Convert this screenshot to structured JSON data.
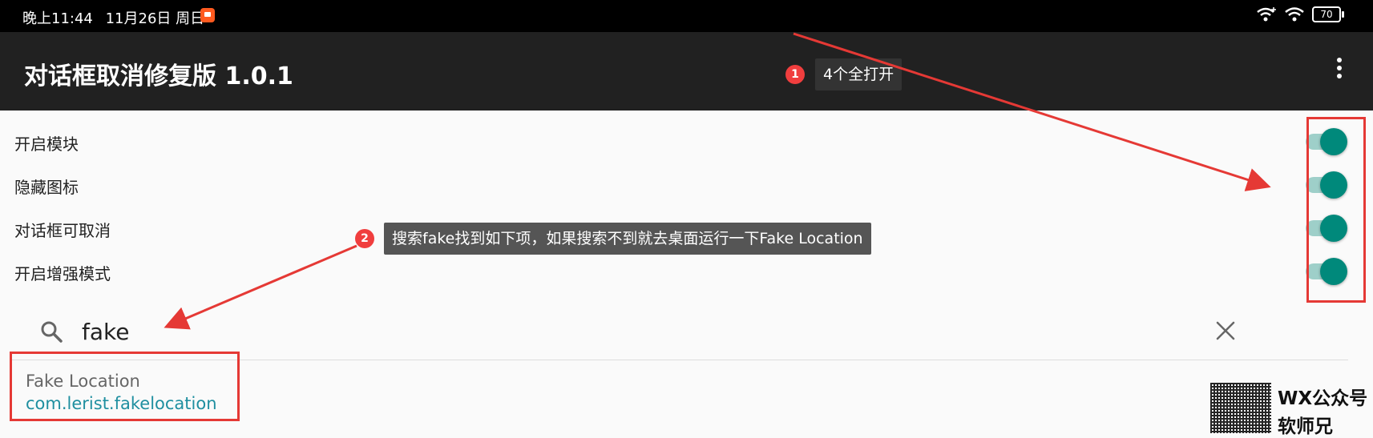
{
  "status_bar": {
    "time": "晚上11:44",
    "date": "11月26日 周日",
    "battery": "70"
  },
  "app_bar": {
    "title": "对话框取消修复版 1.0.1",
    "menu_icon": "more-vert-icon"
  },
  "annotations": [
    {
      "number": "1",
      "text": "4个全打开"
    },
    {
      "number": "2",
      "text": "搜索fake找到如下项，如果搜索不到就去桌面运行一下Fake Location"
    }
  ],
  "preferences": [
    {
      "label": "开启模块",
      "enabled": true
    },
    {
      "label": "隐藏图标",
      "enabled": true
    },
    {
      "label": "对话框可取消",
      "enabled": true
    },
    {
      "label": "开启增强模式",
      "enabled": true
    }
  ],
  "search": {
    "value": "fake",
    "icon": "search-icon",
    "clear_icon": "close-icon"
  },
  "results": [
    {
      "name": "Fake Location",
      "package": "com.lerist.fakelocation"
    }
  ],
  "watermark": {
    "line1": "WX公众号",
    "line2": "软师兄"
  },
  "colors": {
    "accent": "#00897b",
    "annotation_red": "#e53935",
    "app_bar": "#212121",
    "package_text": "#1f8fa0"
  }
}
